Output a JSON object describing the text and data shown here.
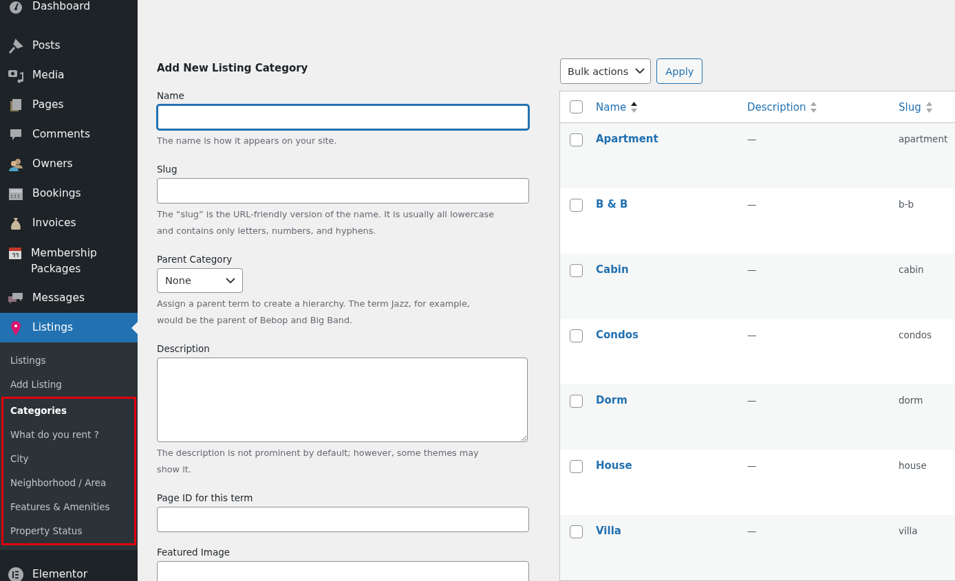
{
  "sidebar": {
    "items": [
      {
        "label": "Dashboard",
        "selected": false
      },
      {
        "label": "Posts",
        "selected": false
      },
      {
        "label": "Media",
        "selected": false
      },
      {
        "label": "Pages",
        "selected": false
      },
      {
        "label": "Comments",
        "selected": false
      },
      {
        "label": "Owners",
        "selected": false
      },
      {
        "label": "Bookings",
        "selected": false
      },
      {
        "label": "Invoices",
        "selected": false
      },
      {
        "label": "Membership Packages",
        "selected": false
      },
      {
        "label": "Messages",
        "selected": false
      },
      {
        "label": "Listings",
        "selected": true,
        "submenu": [
          {
            "label": "Listings",
            "selected": false,
            "highlighted": false
          },
          {
            "label": "Add Listing",
            "selected": false,
            "highlighted": false
          },
          {
            "label": "Categories",
            "selected": true,
            "highlighted": true
          },
          {
            "label": "What do you rent ?",
            "selected": false,
            "highlighted": true
          },
          {
            "label": "City",
            "selected": false,
            "highlighted": true
          },
          {
            "label": "Neighborhood / Area",
            "selected": false,
            "highlighted": true
          },
          {
            "label": "Features & Amenities",
            "selected": false,
            "highlighted": true
          },
          {
            "label": "Property Status",
            "selected": false,
            "highlighted": true
          }
        ]
      },
      {
        "label": "Elementor",
        "selected": false
      }
    ]
  },
  "form": {
    "title": "Add New Listing Category",
    "fields": [
      {
        "kind": "text",
        "label": "Name",
        "focused": true,
        "help": [
          "The name is how it appears on your site."
        ]
      },
      {
        "kind": "text",
        "label": "Slug",
        "focused": false,
        "help": [
          "The “slug” is the URL-friendly version of the name. It is usually all lowercase",
          "and contains only letters, numbers, and hyphens."
        ]
      },
      {
        "kind": "select",
        "label": "Parent Category",
        "value": "None",
        "focused": false,
        "help": [
          "Assign a parent term to create a hierarchy. The term Jazz, for example,",
          "would be the parent of Bebop and Big Band."
        ]
      },
      {
        "kind": "textarea",
        "label": "Description",
        "focused": false,
        "help": [
          "The description is not prominent by default; however, some themes may",
          "show it."
        ]
      },
      {
        "kind": "text",
        "label": "Page ID for this term",
        "focused": false
      },
      {
        "kind": "text",
        "label": "Featured Image",
        "focused": false
      }
    ]
  },
  "table": {
    "bulk_actions": "Bulk actions",
    "apply": "Apply",
    "select_all_checked": false,
    "columns": [
      {
        "label": "Name",
        "sorted": true
      },
      {
        "label": "Description",
        "sorted": false
      },
      {
        "label": "Slug",
        "sorted": false
      }
    ],
    "rows": [
      {
        "name": "Apartment",
        "description": "—",
        "slug": "apartment",
        "checked": false
      },
      {
        "name": "B & B",
        "description": "—",
        "slug": "b-b",
        "checked": false
      },
      {
        "name": "Cabin",
        "description": "—",
        "slug": "cabin",
        "checked": false
      },
      {
        "name": "Condos",
        "description": "—",
        "slug": "condos",
        "checked": false
      },
      {
        "name": "Dorm",
        "description": "—",
        "slug": "dorm",
        "checked": false
      },
      {
        "name": "House",
        "description": "—",
        "slug": "house",
        "checked": false
      },
      {
        "name": "Villa",
        "description": "—",
        "slug": "villa",
        "checked": false
      }
    ]
  }
}
